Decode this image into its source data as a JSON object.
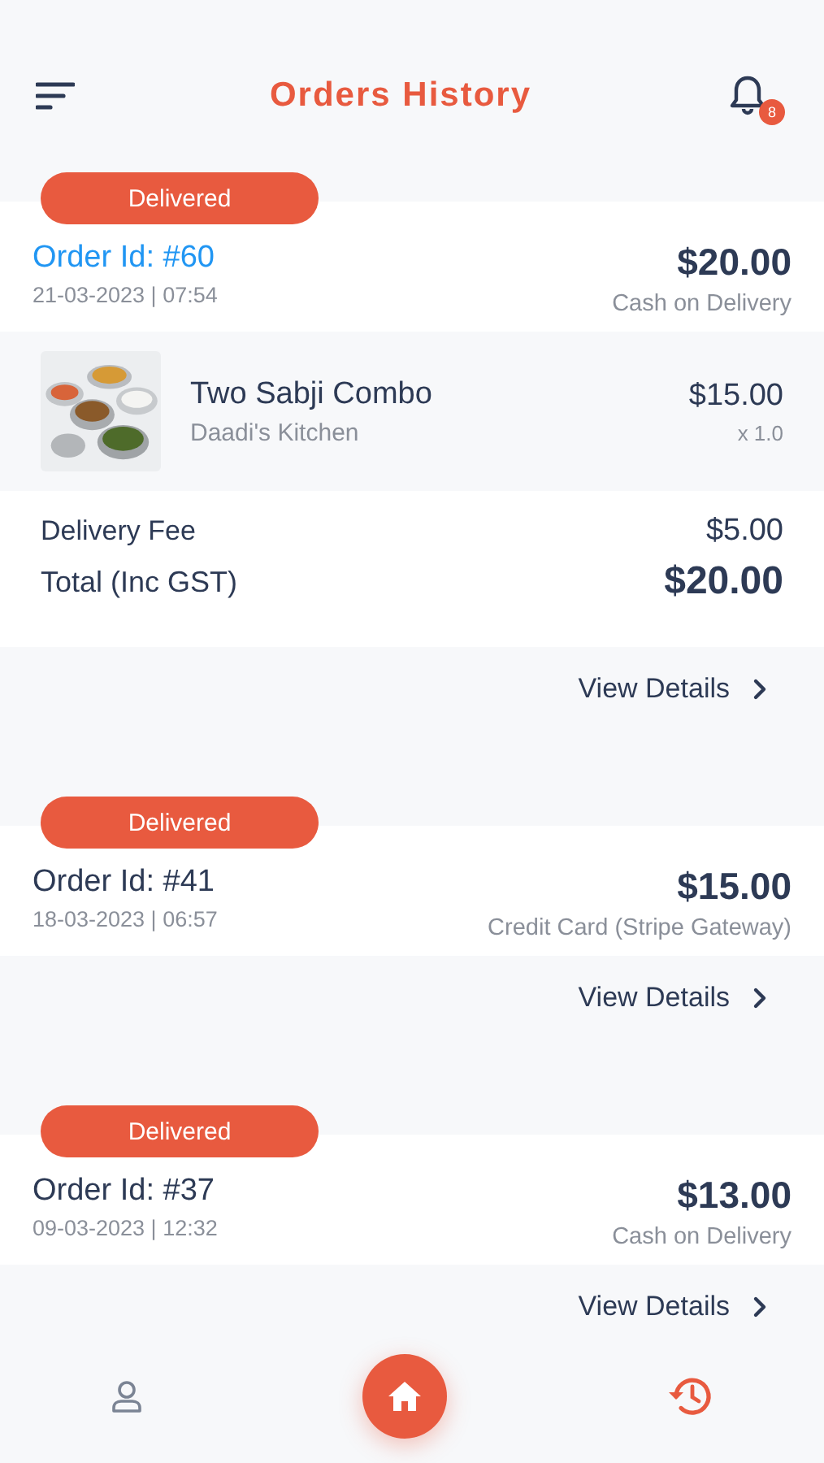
{
  "header": {
    "title": "Orders History",
    "notification_count": "8"
  },
  "orders": [
    {
      "status": "Delivered",
      "order_id": "Order Id: #60",
      "highlighted": true,
      "datetime": "21-03-2023 | 07:54",
      "amount": "$20.00",
      "payment": "Cash on Delivery",
      "items": [
        {
          "name": "Two Sabji Combo",
          "restaurant": "Daadi's Kitchen",
          "price": "$15.00",
          "quantity": "x 1.0"
        }
      ],
      "fees": [
        {
          "label": "Delivery Fee",
          "value": "$5.00",
          "kind": "fee"
        },
        {
          "label": "Total (Inc GST)",
          "value": "$20.00",
          "kind": "total"
        }
      ],
      "link": "View Details"
    },
    {
      "status": "Delivered",
      "order_id": "Order Id: #41",
      "highlighted": false,
      "datetime": "18-03-2023 | 06:57",
      "amount": "$15.00",
      "payment": "Credit Card (Stripe Gateway)",
      "link": "View Details"
    },
    {
      "status": "Delivered",
      "order_id": "Order Id: #37",
      "highlighted": false,
      "datetime": "09-03-2023 | 12:32",
      "amount": "$13.00",
      "payment": "Cash on Delivery",
      "link": "View Details"
    }
  ],
  "bottom_nav": [
    {
      "kind": "profile",
      "selected": false
    },
    {
      "kind": "home",
      "selected": false
    },
    {
      "kind": "history",
      "selected": true
    }
  ]
}
